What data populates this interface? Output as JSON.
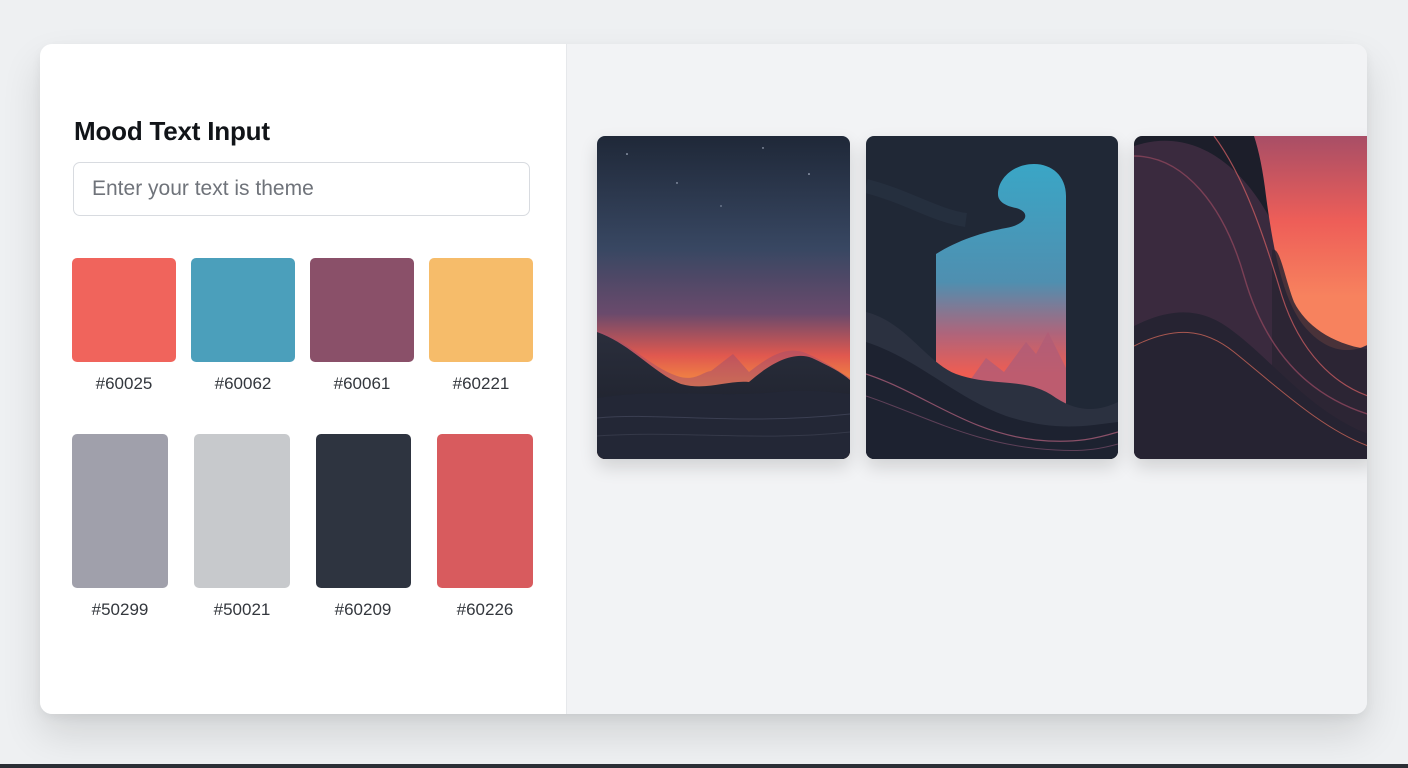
{
  "panel": {
    "title": "Mood Text Input",
    "input_placeholder": "Enter your text is theme",
    "input_value": ""
  },
  "swatches_row1": [
    {
      "label": "#60025",
      "color": "#f0645c"
    },
    {
      "label": "#60062",
      "color": "#4b9fbb"
    },
    {
      "label": "#60061",
      "color": "#8a5069"
    },
    {
      "label": "#60221",
      "color": "#f6bc6a"
    }
  ],
  "swatches_row2": [
    {
      "label": "#50299",
      "color": "#a0a0ab"
    },
    {
      "label": "#50021",
      "color": "#c7c9cc"
    },
    {
      "label": "#60209",
      "color": "#2e3440"
    },
    {
      "label": "#60226",
      "color": "#d85b5e"
    }
  ],
  "gallery": {
    "images": [
      {
        "name": "mountain-sunset-artwork"
      },
      {
        "name": "portal-arch-artwork"
      },
      {
        "name": "abstract-waves-artwork"
      }
    ]
  },
  "colors": {
    "accent_coral": "#f0645c",
    "accent_teal": "#4b9fbb",
    "deep_navy": "#1f2633"
  }
}
